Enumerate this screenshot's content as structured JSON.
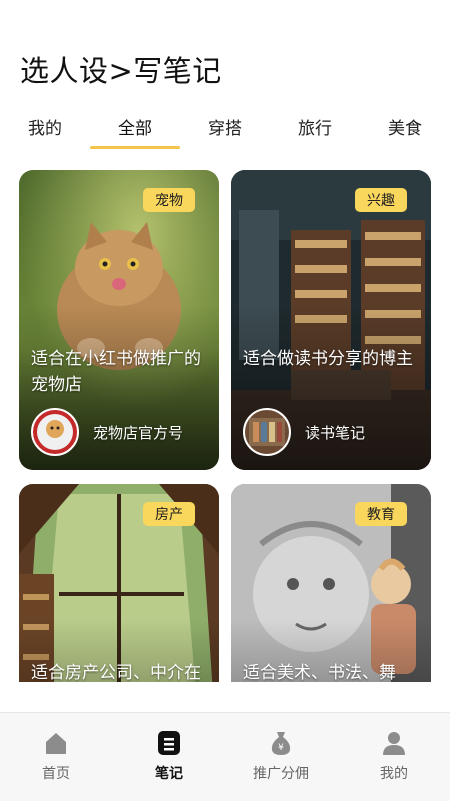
{
  "header": {
    "title": "选人设>写笔记"
  },
  "tabs": [
    {
      "label": "我的"
    },
    {
      "label": "全部"
    },
    {
      "label": "穿搭"
    },
    {
      "label": "旅行"
    },
    {
      "label": "美食"
    }
  ],
  "active_tab": "全部",
  "cards": [
    {
      "tag": "宠物",
      "title": "适合在小红书做推广的宠物店",
      "author": "宠物店官方号",
      "avatar_text": "PPE SHOP"
    },
    {
      "tag": "兴趣",
      "title": "适合做读书分享的博主",
      "author": "读书笔记"
    },
    {
      "tag": "房产",
      "title": "适合房产公司、中介在"
    },
    {
      "tag": "教育",
      "title": "适合美术、书法、舞"
    }
  ],
  "bottom_nav": [
    {
      "label": "首页",
      "icon": "home-icon"
    },
    {
      "label": "笔记",
      "icon": "note-icon"
    },
    {
      "label": "推广分佣",
      "icon": "money-bag-icon"
    },
    {
      "label": "我的",
      "icon": "user-icon"
    }
  ],
  "active_nav": "笔记",
  "colors": {
    "accent": "#f5c44a",
    "tag_bg": "#f9d65c"
  }
}
